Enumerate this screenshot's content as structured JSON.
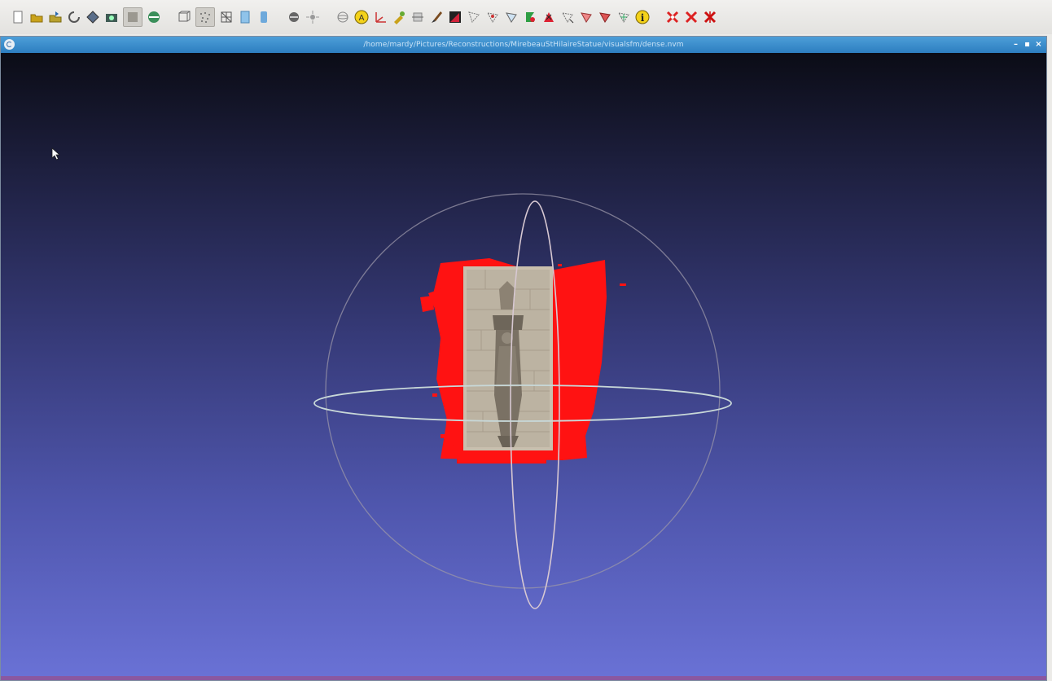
{
  "window": {
    "title": "/home/mardy/Pictures/Reconstructions/MirebeauStHilaireStatue/visualsfm/dense.nvm"
  },
  "toolbar": {
    "icons": [
      "new-project-icon",
      "open-project-icon",
      "import-mesh-icon",
      "reload-icon",
      "export-mesh-icon",
      "snapshot-icon",
      "toggle-panel-icon",
      "layer-icon",
      "bounding-box-icon",
      "points-render-icon",
      "wireframe-render-icon",
      "flat-render-icon",
      "smooth-render-icon",
      "texture-icon",
      "lighting-icon",
      "trackball-icon",
      "annotation-icon",
      "axis-icon",
      "paint-icon",
      "measure-icon",
      "brush-icon",
      "color-paint-icon",
      "select-faces-icon",
      "select-vertices-icon",
      "select-connected-icon",
      "select-z-painting-icon",
      "delete-selection-icon",
      "select-region-icon",
      "align-icon",
      "align-alt-icon",
      "pick-points-icon",
      "info-icon",
      "delete-vertices-icon",
      "delete-faces-icon",
      "delete-all-icon"
    ]
  },
  "titlebar_buttons": {
    "minimize": "–",
    "maximize": "▪",
    "close": "×"
  },
  "colors": {
    "titlebar": "#2d7ec0",
    "point_cloud": "#ff1010",
    "trackball_ring": "#c9c0cc"
  }
}
